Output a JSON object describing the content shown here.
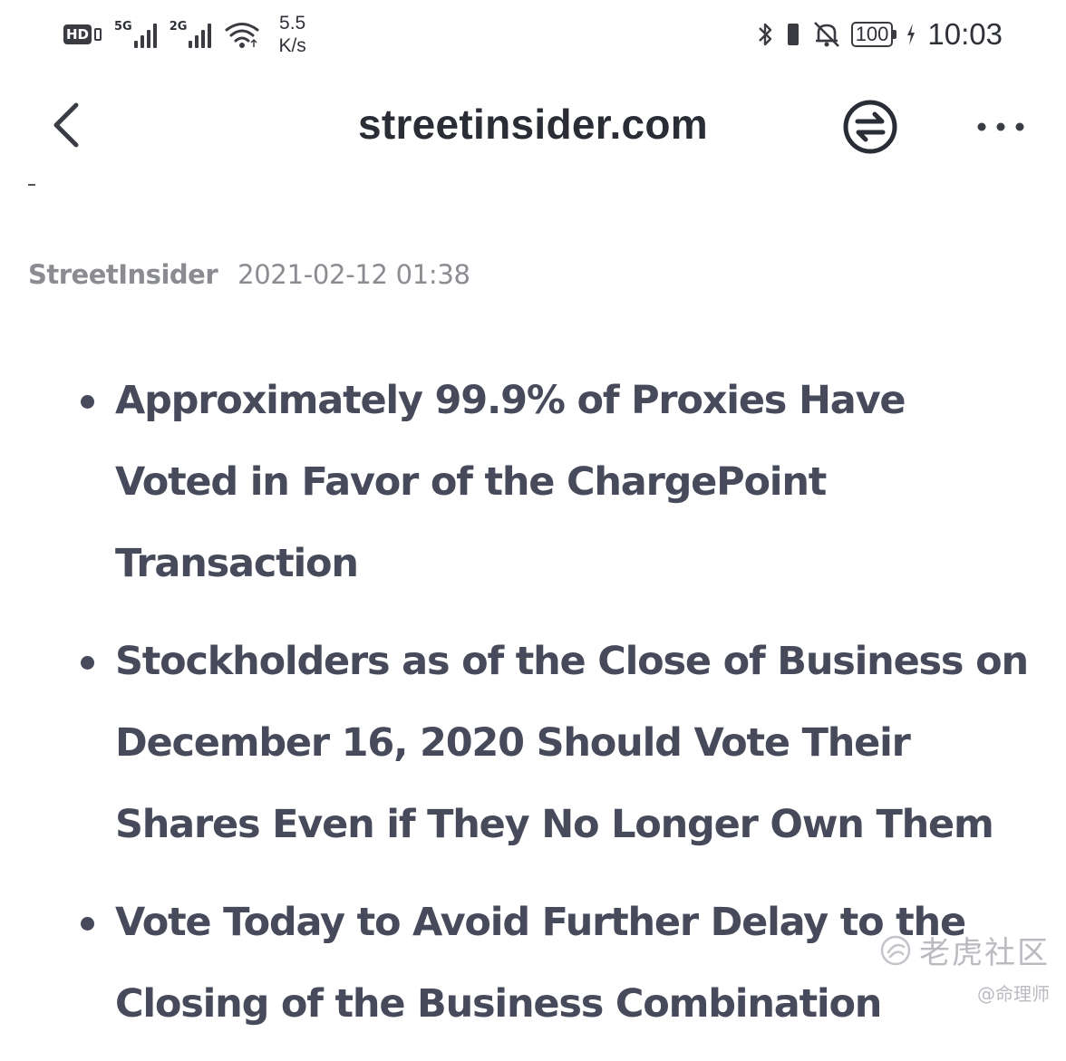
{
  "status_bar": {
    "hd_label": "HD",
    "network_1": "5G",
    "network_2": "2G",
    "speed_value": "5.5",
    "speed_unit": "K/s",
    "battery_level": "100",
    "time": "10:03",
    "icons": [
      "hd-icon",
      "signal-5g-icon",
      "signal-2g-icon",
      "wifi-icon",
      "bluetooth-icon",
      "vibrate-icon",
      "bell-off-icon",
      "battery-icon",
      "charging-icon"
    ]
  },
  "nav": {
    "title": "streetinsider.com",
    "icons": [
      "back-chevron-icon",
      "switch-arrows-icon",
      "more-dots-icon"
    ]
  },
  "article": {
    "source": "StreetInsider",
    "date": "2021-02-12 01:38",
    "bullets": [
      "Approximately 99.9% of Proxies Have Voted in Favor of the ChargePoint Transaction",
      "Stockholders as of the Close of Business on December 16, 2020 Should Vote Their Shares Even if They No Longer Own Them",
      "Vote Today to Avoid Further Delay to the Closing of the Business Combination"
    ]
  },
  "watermark": {
    "logo_text": "老虎社区",
    "handle": "@命理师"
  },
  "colors": {
    "text_primary": "#464a5a",
    "title": "#2b2d36",
    "meta": "#8a8c91",
    "watermark": "#b9bbc0"
  }
}
